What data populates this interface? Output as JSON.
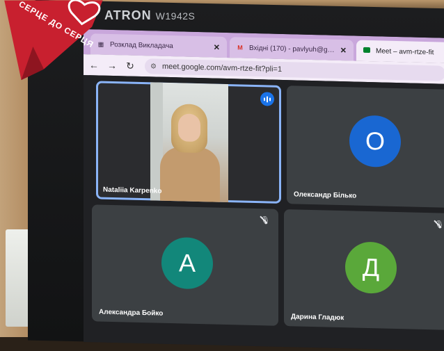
{
  "monitor": {
    "brand": "ATRON",
    "model": "W1942S"
  },
  "decoration": {
    "ribbon_text": "СЕРЦЕ ДО СЕРЦЯ"
  },
  "browser": {
    "tabs": [
      {
        "label": "Розклад Викладача",
        "icon": "calendar-icon"
      },
      {
        "label": "Вхідні (170) - pavlyuh@gmail.com",
        "icon": "gmail-icon"
      },
      {
        "label": "Meet – avm-rtze-fit",
        "icon": "meet-icon"
      }
    ],
    "url": "meet.google.com/avm-rtze-fit?pli=1"
  },
  "meet": {
    "participants": [
      {
        "name": "Nataliia Karpenko",
        "type": "video",
        "speaking": true
      },
      {
        "name": "Олександр Білько",
        "initial": "О",
        "color": "#1967d2",
        "muted": false
      },
      {
        "name": "Александра Бойко",
        "initial": "А",
        "color": "#12877a",
        "muted": true
      },
      {
        "name": "Дарина Гладюк",
        "initial": "Д",
        "color": "#5aa83a",
        "muted": true
      }
    ]
  },
  "colors": {
    "speaking_outline": "#8ab4f8",
    "tab_bar": "#c9a7dc"
  }
}
